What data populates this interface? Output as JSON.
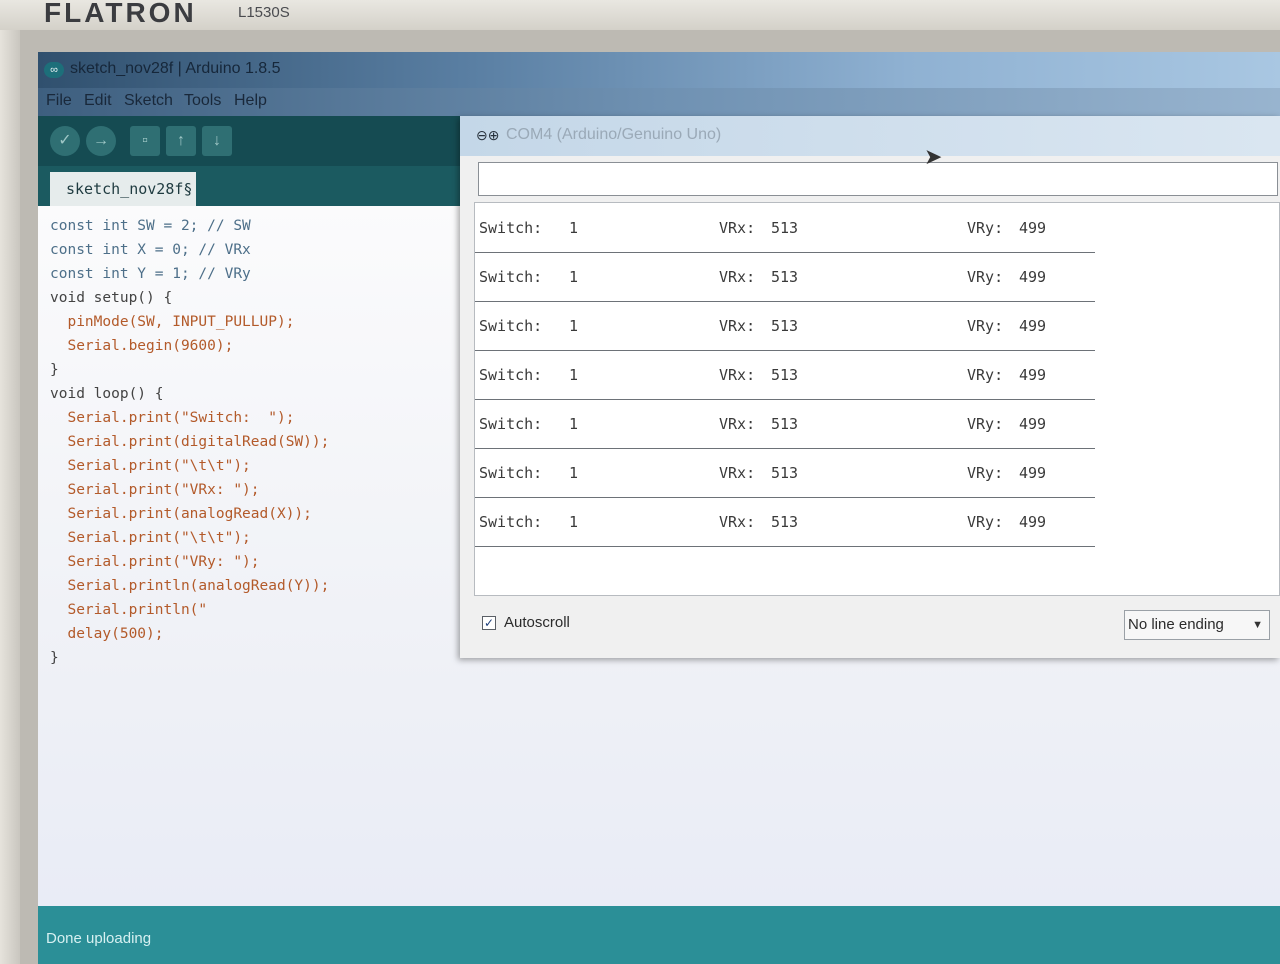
{
  "monitor": {
    "brand": "FLATRON",
    "model": "L1530S"
  },
  "window": {
    "title": "sketch_nov28f | Arduino 1.8.5"
  },
  "menu": [
    "File",
    "Edit",
    "Sketch",
    "Tools",
    "Help"
  ],
  "tab": {
    "label": "sketch_nov28f§"
  },
  "code_lines": [
    "const int SW = 2; // SW",
    "const int X = 0; // VRx",
    "const int Y = 1; // VRy",
    "void setup() {",
    "  pinMode(SW, INPUT_PULLUP);",
    "  Serial.begin(9600);",
    "}",
    "void loop() {",
    "  Serial.print(\"Switch:  \");",
    "  Serial.print(digitalRead(SW));",
    "  Serial.print(\"\\t\\t\");",
    "  Serial.print(\"VRx: \");",
    "  Serial.print(analogRead(X));",
    "  Serial.print(\"\\t\\t\");",
    "  Serial.print(\"VRy: \");",
    "  Serial.println(analogRead(Y));",
    "  Serial.println(\"",
    "  delay(500);",
    "}"
  ],
  "status": {
    "text": "Done uploading"
  },
  "serial_monitor": {
    "title": "COM4 (Arduino/Genuino Uno)",
    "input_value": "",
    "rows": [
      {
        "switch_label": "Switch:",
        "switch": "1",
        "vrx_label": "VRx:",
        "vrx": "513",
        "vry_label": "VRy:",
        "vry": "499"
      },
      {
        "switch_label": "Switch:",
        "switch": "1",
        "vrx_label": "VRx:",
        "vrx": "513",
        "vry_label": "VRy:",
        "vry": "499"
      },
      {
        "switch_label": "Switch:",
        "switch": "1",
        "vrx_label": "VRx:",
        "vrx": "513",
        "vry_label": "VRy:",
        "vry": "499"
      },
      {
        "switch_label": "Switch:",
        "switch": "1",
        "vrx_label": "VRx:",
        "vrx": "513",
        "vry_label": "VRy:",
        "vry": "499"
      },
      {
        "switch_label": "Switch:",
        "switch": "1",
        "vrx_label": "VRx:",
        "vrx": "513",
        "vry_label": "VRy:",
        "vry": "499"
      },
      {
        "switch_label": "Switch:",
        "switch": "1",
        "vrx_label": "VRx:",
        "vrx": "513",
        "vry_label": "VRy:",
        "vry": "499"
      },
      {
        "switch_label": "Switch:",
        "switch": "1",
        "vrx_label": "VRx:",
        "vrx": "513",
        "vry_label": "VRy:",
        "vry": "499"
      }
    ],
    "autoscroll": {
      "label": "Autoscroll",
      "checked": true
    },
    "line_ending": {
      "selected": "No line ending"
    }
  },
  "icons": {
    "app": "arduino-logo-icon",
    "verify": "check-icon",
    "upload": "arrow-right-icon",
    "new": "new-file-icon",
    "open": "arrow-up-icon",
    "save": "arrow-down-icon",
    "dropdown": "chevron-down-icon",
    "cursor": "mouse-pointer-icon"
  }
}
